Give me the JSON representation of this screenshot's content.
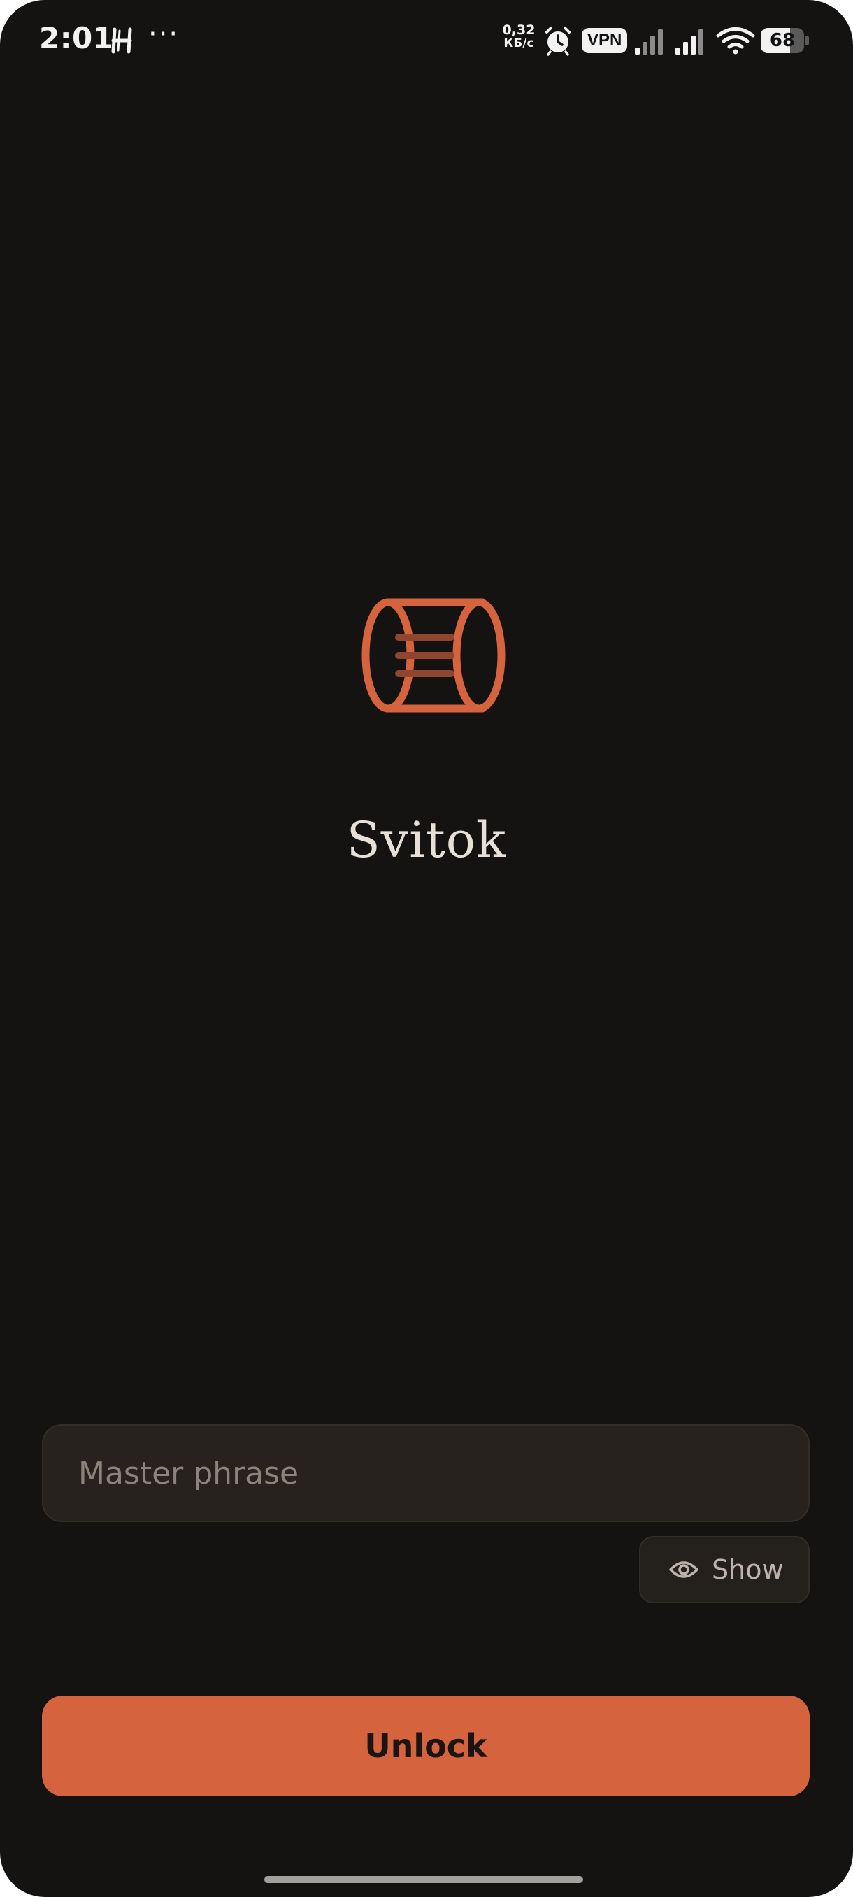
{
  "status_bar": {
    "time": "2:01",
    "more": "···",
    "speed_value": "0,32",
    "speed_unit": "КБ/с",
    "vpn": "VPN",
    "battery_percent": 68,
    "battery_text": "68",
    "icons": [
      "h-notification-icon",
      "alarm-icon",
      "signal-icon",
      "signal-icon",
      "wifi-icon",
      "battery-icon"
    ]
  },
  "app": {
    "logo": "scroll-icon",
    "title": "Svitok"
  },
  "form": {
    "phrase_placeholder": "Master phrase",
    "phrase_value": "",
    "show_label": "Show",
    "unlock_label": "Unlock"
  },
  "colors": {
    "background": "#141312",
    "accent": "#d5633e",
    "field_background": "#27221d",
    "title_text": "#e6e0d8"
  }
}
